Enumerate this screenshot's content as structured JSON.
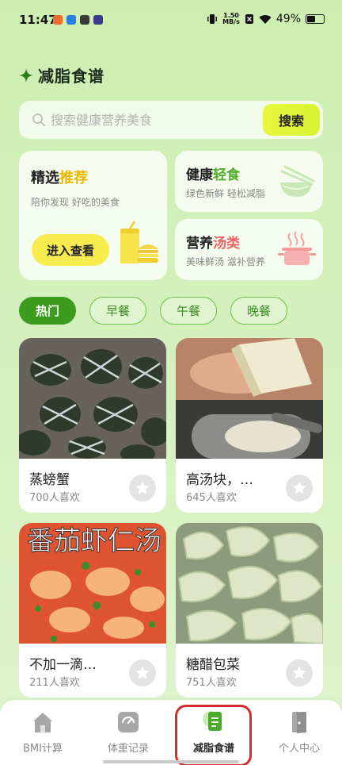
{
  "status_bar": {
    "time": "11:47",
    "net_speed_value": "1.50",
    "net_speed_unit": "MB/s",
    "battery": "49%"
  },
  "header": {
    "title": "减脂食谱"
  },
  "search": {
    "placeholder": "搜索健康营养美食",
    "button": "搜索"
  },
  "featured": {
    "title_prefix": "精选",
    "title_highlight": "推荐",
    "subtitle": "陪你发现 好吃的美食",
    "button": "进入查看"
  },
  "light_meal": {
    "title_prefix": "健康",
    "title_highlight": "轻食",
    "subtitle": "绿色新鲜 轻松减脂"
  },
  "soup": {
    "title_prefix": "营养",
    "title_highlight": "汤类",
    "subtitle": "美味鲜汤 滋补营养"
  },
  "chips": [
    "热门",
    "早餐",
    "午餐",
    "晚餐"
  ],
  "recipes": [
    {
      "name": "蒸螃蟹",
      "likes": "700人喜欢"
    },
    {
      "name": "高汤块，…",
      "likes": "645人喜欢"
    },
    {
      "name": "不加一滴…",
      "likes": "211人喜欢"
    },
    {
      "name": "糖醋包菜",
      "likes": "751人喜欢"
    }
  ],
  "photo_overlay_text": "番茄虾仁汤",
  "nav": {
    "items": [
      {
        "label": "BMI计算",
        "icon": "home-icon"
      },
      {
        "label": "体重记录",
        "icon": "scale-icon"
      },
      {
        "label": "减脂食谱",
        "icon": "recipe-icon"
      },
      {
        "label": "个人中心",
        "icon": "door-icon"
      }
    ],
    "active_index": 2
  },
  "colors": {
    "accent_green": "#3c9c1e",
    "highlight_yellow": "#e9b800",
    "highlight_green": "#4caf25",
    "highlight_red": "#ef6060",
    "annotation_red": "#d42b2b"
  }
}
